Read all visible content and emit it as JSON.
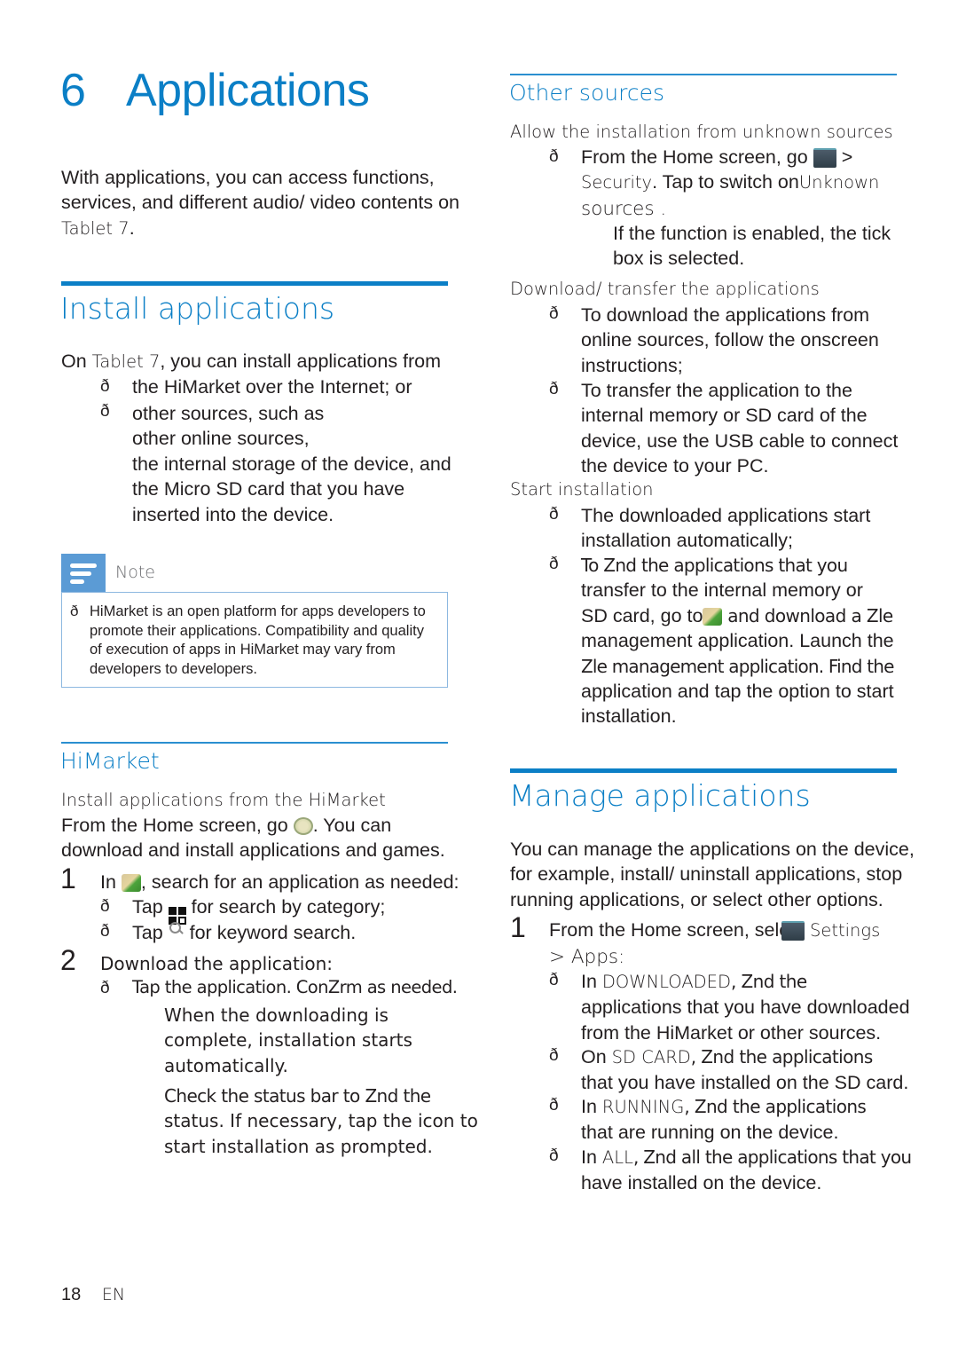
{
  "chapter": {
    "number": "6",
    "title": "Applications"
  },
  "intro": {
    "lines": [
      "With applications, you can access functions,",
      "services, and different audio/ video contents on"
    ],
    "device": "Tablet 7",
    "period": "."
  },
  "install": {
    "heading": "Install applications",
    "lead_on": "On",
    "lead_device": "Tablet 7",
    "lead_rest": ", you can install applications from",
    "bullet_glyph": "ð",
    "bullets": [
      {
        "lines": [
          "the HiMarket over the Internet; or"
        ]
      },
      {
        "lines": [
          "other sources, such as",
          "other online sources,",
          "the internal storage of the device, and",
          "the Micro SD card that you have",
          "inserted into the device."
        ]
      }
    ]
  },
  "note": {
    "label": "Note",
    "bullet_glyph": "ð",
    "lines": [
      "HiMarket is an open platform for apps developers to",
      "promote their applications. Compatibility and quality",
      "of execution of apps in HiMarket may vary from",
      "developers to developers."
    ]
  },
  "himarket": {
    "heading": "HiMarket",
    "subheading": "Install applications from the HiMarket",
    "intro_a": "From the Home screen, go",
    "intro_b": ". You can",
    "intro_line2": "download and install applications and games.",
    "step1": {
      "num": "1",
      "a": "In",
      "b": ", search for an application as needed:",
      "bullets": [
        {
          "a": "Tap",
          "b": " for search by category;"
        },
        {
          "a": "Tap",
          "b": " for keyword search."
        }
      ]
    },
    "step2": {
      "num": "2",
      "text": "Download the application:",
      "bullet": "Tap the application. ConZrm as needed.",
      "result1": [
        "When the downloading is",
        "complete, installation starts",
        "automatically."
      ],
      "result2": [
        "Check the status bar to Znd the",
        "status. If necessary, tap the icon to",
        "start installation as prompted."
      ]
    }
  },
  "other_sources": {
    "heading": "Other sources",
    "sub1": "Allow the installation from unknown sources",
    "b1_a": "From the Home screen, go",
    "b1_b": ">",
    "b1_security": "Security",
    "b1_c": ". Tap to switch on",
    "b1_unknown": "Unknown",
    "b1_sources": "sources .",
    "result": [
      "If the function is enabled, the tick",
      "box is selected."
    ],
    "sub2": "Download/ transfer the applications",
    "dl_bullets": [
      [
        "To download the applications from",
        "online sources, follow the onscreen",
        "instructions;"
      ],
      [
        "To transfer the application to the",
        "internal memory or SD card of the",
        "device, use the USB cable to connect",
        "the device to your PC."
      ]
    ],
    "sub3": "Start installation",
    "start_b1": [
      "The downloaded applications start",
      "installation automatically;"
    ],
    "start_b2": {
      "l1": "To Znd the applications that you",
      "l2": "transfer to the internal memory or",
      "l3a": "SD card, go to",
      "l3b": " and download a Zle",
      "rest": [
        "management application. Launch the",
        "Zle management application. Find the",
        "application and tap the option to start",
        "installation."
      ]
    }
  },
  "manage": {
    "heading": "Manage applications",
    "intro": [
      "You can manage the applications on the device,",
      "for example, install/ uninstall applications, stop",
      "running applications, or select other options."
    ],
    "step1": {
      "num": "1",
      "a": "From the Home screen, select",
      "settings": "Settings",
      "apps": "> Apps:"
    },
    "bullets": [
      {
        "pre": "In ",
        "tab": "DOWNLOADED",
        "post": ", Znd the",
        "more": [
          "applications that you have downloaded",
          "from the HiMarket or other sources."
        ]
      },
      {
        "pre": "On ",
        "tab": "SD CARD",
        "post": ", Znd the applications",
        "more": [
          "that you have installed on the SD card."
        ]
      },
      {
        "pre": "In ",
        "tab": "RUNNING",
        "post": ", Znd the applications",
        "more": [
          "that are running on the device."
        ]
      },
      {
        "pre": "In ",
        "tab": "ALL",
        "post": ", Znd all the applications that you",
        "more": [
          "have installed on the device."
        ]
      }
    ]
  },
  "footer": {
    "page": "18",
    "lang": "EN"
  },
  "colors": {
    "accent": "#0b7fc6",
    "note_icon": "#5b9bd5",
    "note_border": "#8db8e0",
    "text": "#231f20"
  }
}
